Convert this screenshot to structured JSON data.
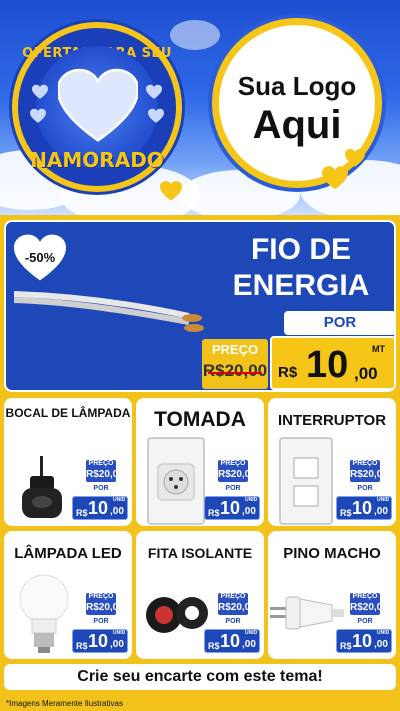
{
  "header": {
    "badge_top": "OFERTAS PARA SEU",
    "badge_bottom": "NAMORADO",
    "logo_line1": "Sua Logo",
    "logo_line2": "Aqui"
  },
  "feature": {
    "discount": "-50%",
    "title_line1": "FIO DE",
    "title_line2": "ENERGIA",
    "por": "POR",
    "preco_label": "PREÇO",
    "old_price": "R$20,00",
    "currency": "R$",
    "price_int": "10",
    "price_dec": ",00",
    "unit": "MT"
  },
  "products": [
    {
      "name": "BOCAL DE LÂMPADA",
      "icon": "lamp-socket-icon",
      "preco_label": "PREÇO",
      "old_price": "R$20,00",
      "por": "POR",
      "currency": "R$",
      "price_int": "10",
      "price_dec": ",00",
      "unit": "UNID"
    },
    {
      "name": "TOMADA",
      "icon": "power-outlet-icon",
      "preco_label": "PREÇO",
      "old_price": "R$20,00",
      "por": "POR",
      "currency": "R$",
      "price_int": "10",
      "price_dec": ",00",
      "unit": "UNID"
    },
    {
      "name": "INTERRUPTOR",
      "icon": "light-switch-icon",
      "preco_label": "PREÇO",
      "old_price": "R$20,00",
      "por": "POR",
      "currency": "R$",
      "price_int": "10",
      "price_dec": ",00",
      "unit": "UNID"
    },
    {
      "name": "LÂMPADA LED",
      "icon": "led-bulb-icon",
      "preco_label": "PREÇO",
      "old_price": "R$20,00",
      "por": "POR",
      "currency": "R$",
      "price_int": "10",
      "price_dec": ",00",
      "unit": "UNID"
    },
    {
      "name": "FITA ISOLANTE",
      "icon": "insulating-tape-icon",
      "preco_label": "PREÇO",
      "old_price": "R$20,00",
      "por": "POR",
      "currency": "R$",
      "price_int": "10",
      "price_dec": ",00",
      "unit": "UNID"
    },
    {
      "name": "PINO MACHO",
      "icon": "male-plug-icon",
      "preco_label": "PREÇO",
      "old_price": "R$20,00",
      "por": "POR",
      "currency": "R$",
      "price_int": "10",
      "price_dec": ",00",
      "unit": "UNID"
    }
  ],
  "footer": {
    "cta": "Crie seu encarte com este tema!",
    "disclaimer": "*Imagens Meramente Ilustrativas"
  },
  "colors": {
    "brand_blue": "#1e48b8",
    "brand_yellow": "#f5c518",
    "panel_yellow": "#f2c21a"
  }
}
